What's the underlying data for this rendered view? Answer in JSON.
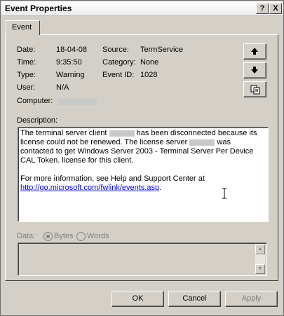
{
  "window": {
    "title": "Event Properties"
  },
  "titlebar": {
    "help_label": "?",
    "close_label": "X"
  },
  "tabs": [
    {
      "label": "Event"
    }
  ],
  "fields": {
    "date_label": "Date:",
    "date_value": "18-04-08",
    "time_label": "Time:",
    "time_value": "9:35:50",
    "type_label": "Type:",
    "type_value": "Warning",
    "user_label": "User:",
    "user_value": "N/A",
    "computer_label": "Computer:",
    "source_label": "Source:",
    "source_value": "TermService",
    "category_label": "Category:",
    "category_value": "None",
    "event_id_label": "Event ID:",
    "event_id_value": "1028"
  },
  "description": {
    "label": "Description:",
    "p1_a": "The terminal server client",
    "p1_b": "has been disconnected because its license could not be renewed. The license server",
    "p1_c": "was contacted to get Windows Server 2003 - Terminal Server Per Device CAL Token. license for this client.",
    "p2": "For more information, see Help and Support Center at",
    "link": "http://go.microsoft.com/fwlink/events.asp",
    "link_suffix": "."
  },
  "data": {
    "label": "Data:",
    "option_bytes": "Bytes",
    "option_words": "Words",
    "selected": "Bytes"
  },
  "buttons": {
    "ok": "OK",
    "cancel": "Cancel",
    "apply": "Apply"
  },
  "colors": {
    "dialog_bg": "#d4d0c8",
    "link": "#0000ee",
    "disabled_text": "#808080"
  },
  "icons": [
    "help-icon",
    "close-icon",
    "arrow-up-icon",
    "arrow-down-icon",
    "copy-icon",
    "text-cursor-icon"
  ]
}
